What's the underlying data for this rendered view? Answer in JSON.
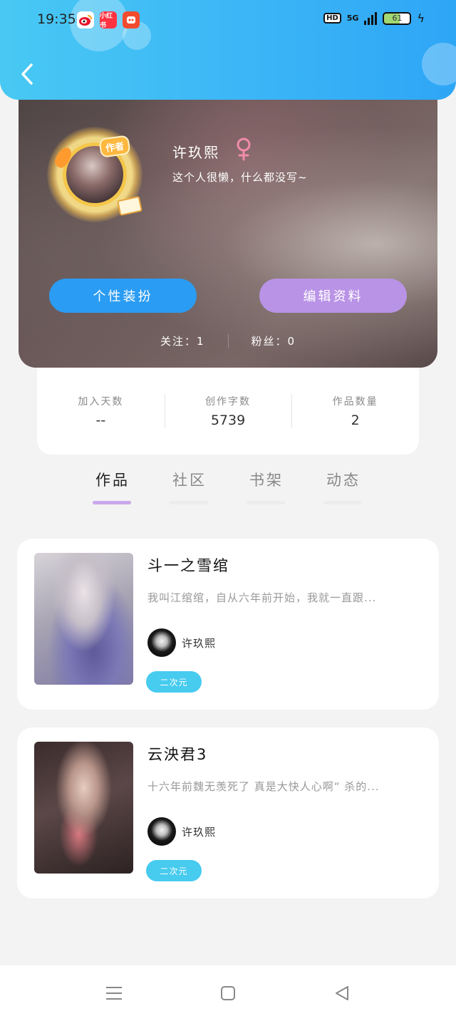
{
  "status_bar": {
    "time": "19:35",
    "network_badge": "HD",
    "network_type": "5G",
    "battery": "61",
    "apps": [
      {
        "icon": "weibo-icon",
        "color": "#f5a623"
      },
      {
        "icon": "xiaohongshu-icon",
        "label": "小红书",
        "color": "#ff3342"
      },
      {
        "icon": "pinduoduo-icon",
        "color": "#f24b2f"
      }
    ]
  },
  "header": {
    "back_icon": "back-arrow-icon",
    "color": "#3db7f6"
  },
  "profile": {
    "name": "许玖熙",
    "gender_icon": "female-icon",
    "bio": "这个人很懒，什么都没写~",
    "badge": "作者",
    "buttons": {
      "dress": "个性装扮",
      "edit": "编辑资料"
    },
    "following": "关注：1",
    "followers": "粉丝：0"
  },
  "stats": [
    {
      "label": "加入天数",
      "value": "--"
    },
    {
      "label": "创作字数",
      "value": "5739"
    },
    {
      "label": "作品数量",
      "value": "2"
    }
  ],
  "tabs": [
    {
      "label": "作品",
      "active": true
    },
    {
      "label": "社区",
      "active": false
    },
    {
      "label": "书架",
      "active": false
    },
    {
      "label": "动态",
      "active": false
    }
  ],
  "works": [
    {
      "title": "斗一之雪绾",
      "description": "我叫江绾绾，自从六年前开始，我就一直跟...",
      "author": "许玖熙",
      "tag": "二次元"
    },
    {
      "title": "云泱君3",
      "description": "十六年前魏无羡死了 真是大快人心啊“ 杀的...",
      "author": "许玖熙",
      "tag": "二次元"
    }
  ],
  "colors": {
    "accent_blue": "#2b9cf3",
    "accent_purple": "#b993e6",
    "tag_cyan": "#47cbef",
    "tab_indicator": "#c9a8eb"
  }
}
